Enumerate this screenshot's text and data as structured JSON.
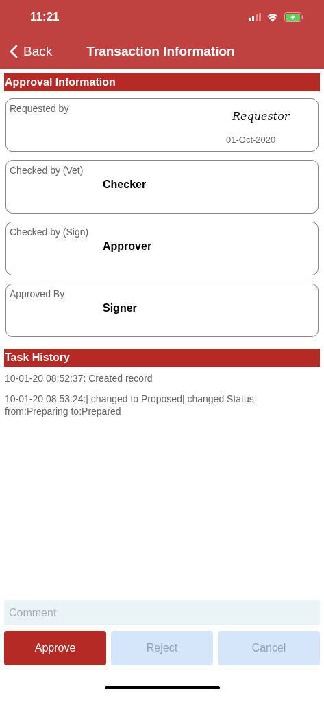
{
  "status_bar": {
    "time": "11:21"
  },
  "nav": {
    "back": "Back",
    "title": "Transaction Information"
  },
  "approval": {
    "heading": "Approval Information",
    "cards": [
      {
        "label": "Requested by",
        "signature": "Requestor",
        "date": "01-Oct-2020"
      },
      {
        "label": "Checked by (Vet)",
        "name": "Checker"
      },
      {
        "label": "Checked by (Sign)",
        "name": "Approver"
      },
      {
        "label": "Approved By",
        "name": "Signer"
      }
    ]
  },
  "history": {
    "heading": "Task History",
    "entries": [
      "10-01-20 08:52:37: Created record",
      "10-01-20 08:53:24:| changed  to Proposed|  changed Status from:Preparing to:Prepared"
    ]
  },
  "comment": {
    "placeholder": "Comment"
  },
  "buttons": [
    {
      "label": "Approve",
      "disabled": false
    },
    {
      "label": "Reject",
      "disabled": true
    },
    {
      "label": "Cancel",
      "disabled": true
    }
  ]
}
